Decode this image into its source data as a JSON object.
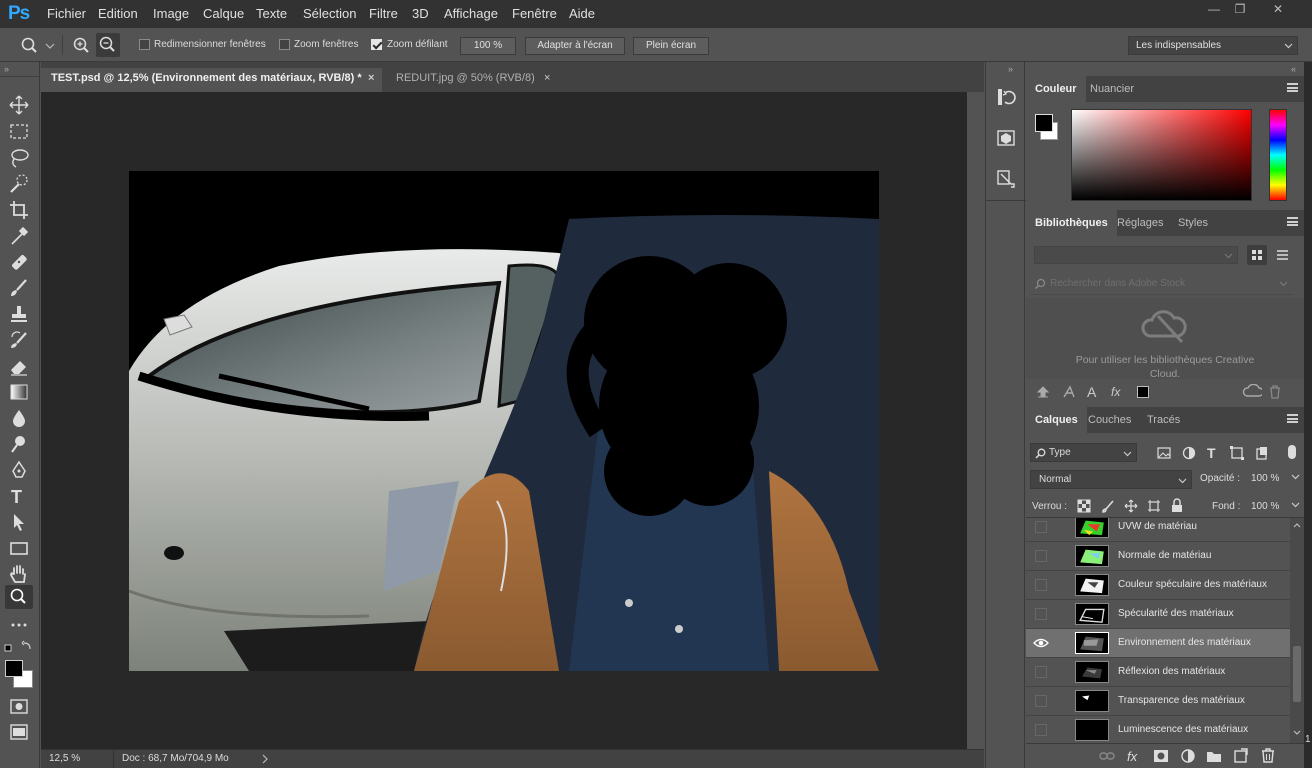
{
  "app": {
    "logo": "Ps"
  },
  "menu": [
    "Fichier",
    "Edition",
    "Image",
    "Calque",
    "Texte",
    "Sélection",
    "Filtre",
    "3D",
    "Affichage",
    "Fenêtre",
    "Aide"
  ],
  "window_controls": {
    "minimize": "—",
    "restore": "❐",
    "close": "✕"
  },
  "options": {
    "resize_windows_label": "Redimensionner fenêtres",
    "zoom_windows_label": "Zoom fenêtres",
    "scrubby_zoom_label": "Zoom défilant",
    "zoom_value": "100 %",
    "fit_screen_label": "Adapter à l'écran",
    "fill_screen_label": "Plein écran",
    "workspace": "Les indispensables",
    "scrubby_zoom_checked": true,
    "resize_windows_checked": false,
    "zoom_windows_checked": false
  },
  "tools": [
    "move-icon",
    "marquee-icon",
    "lasso-icon",
    "quick-select-icon",
    "crop-icon",
    "eyedropper-icon",
    "healing-icon",
    "brush-icon",
    "stamp-icon",
    "history-brush-icon",
    "eraser-icon",
    "gradient-icon",
    "blur-icon",
    "dodge-icon",
    "pen-icon",
    "type-icon",
    "path-select-icon",
    "rectangle-icon",
    "hand-icon",
    "zoom-icon",
    "more-tools-icon"
  ],
  "documents": {
    "tabs": [
      {
        "label": "TEST.psd @ 12,5% (Environnement des matériaux, RVB/8) *",
        "active": true
      },
      {
        "label": "REDUIT.jpg @ 50% (RVB/8)",
        "active": false
      }
    ],
    "close_glyph": "×"
  },
  "status": {
    "zoom": "12,5 %",
    "doc": "Doc : 68,7 Mo/704,9 Mo"
  },
  "color_panel": {
    "tabs": [
      "Couleur",
      "Nuancier"
    ],
    "foreground": "#000000",
    "background": "#ffffff",
    "hue": "#ff0000"
  },
  "libraries_panel": {
    "tabs": [
      "Bibliothèques",
      "Réglages",
      "Styles"
    ],
    "search_placeholder": "Rechercher dans Adobe Stock",
    "message": "Pour utiliser les bibliothèques Creative Cloud."
  },
  "layers_panel": {
    "tabs": [
      "Calques",
      "Couches",
      "Tracés"
    ],
    "filter_kind": "Type",
    "blend_mode": "Normal",
    "opacity_label": "Opacité :",
    "opacity_value": "100 %",
    "lock_label": "Verrou :",
    "fill_label": "Fond :",
    "fill_value": "100 %",
    "layers": [
      {
        "name": "UVW de matériau",
        "visible": false,
        "selected": false
      },
      {
        "name": "Normale de matériau",
        "visible": false,
        "selected": false
      },
      {
        "name": "Couleur spéculaire des matériaux",
        "visible": false,
        "selected": false
      },
      {
        "name": "Spécularité des matériaux",
        "visible": false,
        "selected": false
      },
      {
        "name": "Environnement des matériaux",
        "visible": true,
        "selected": true
      },
      {
        "name": "Réflexion des matériaux",
        "visible": false,
        "selected": false
      },
      {
        "name": "Transparence des matériaux",
        "visible": false,
        "selected": false
      },
      {
        "name": "Luminescence des matériaux",
        "visible": false,
        "selected": false
      }
    ]
  },
  "edge_text": "1"
}
